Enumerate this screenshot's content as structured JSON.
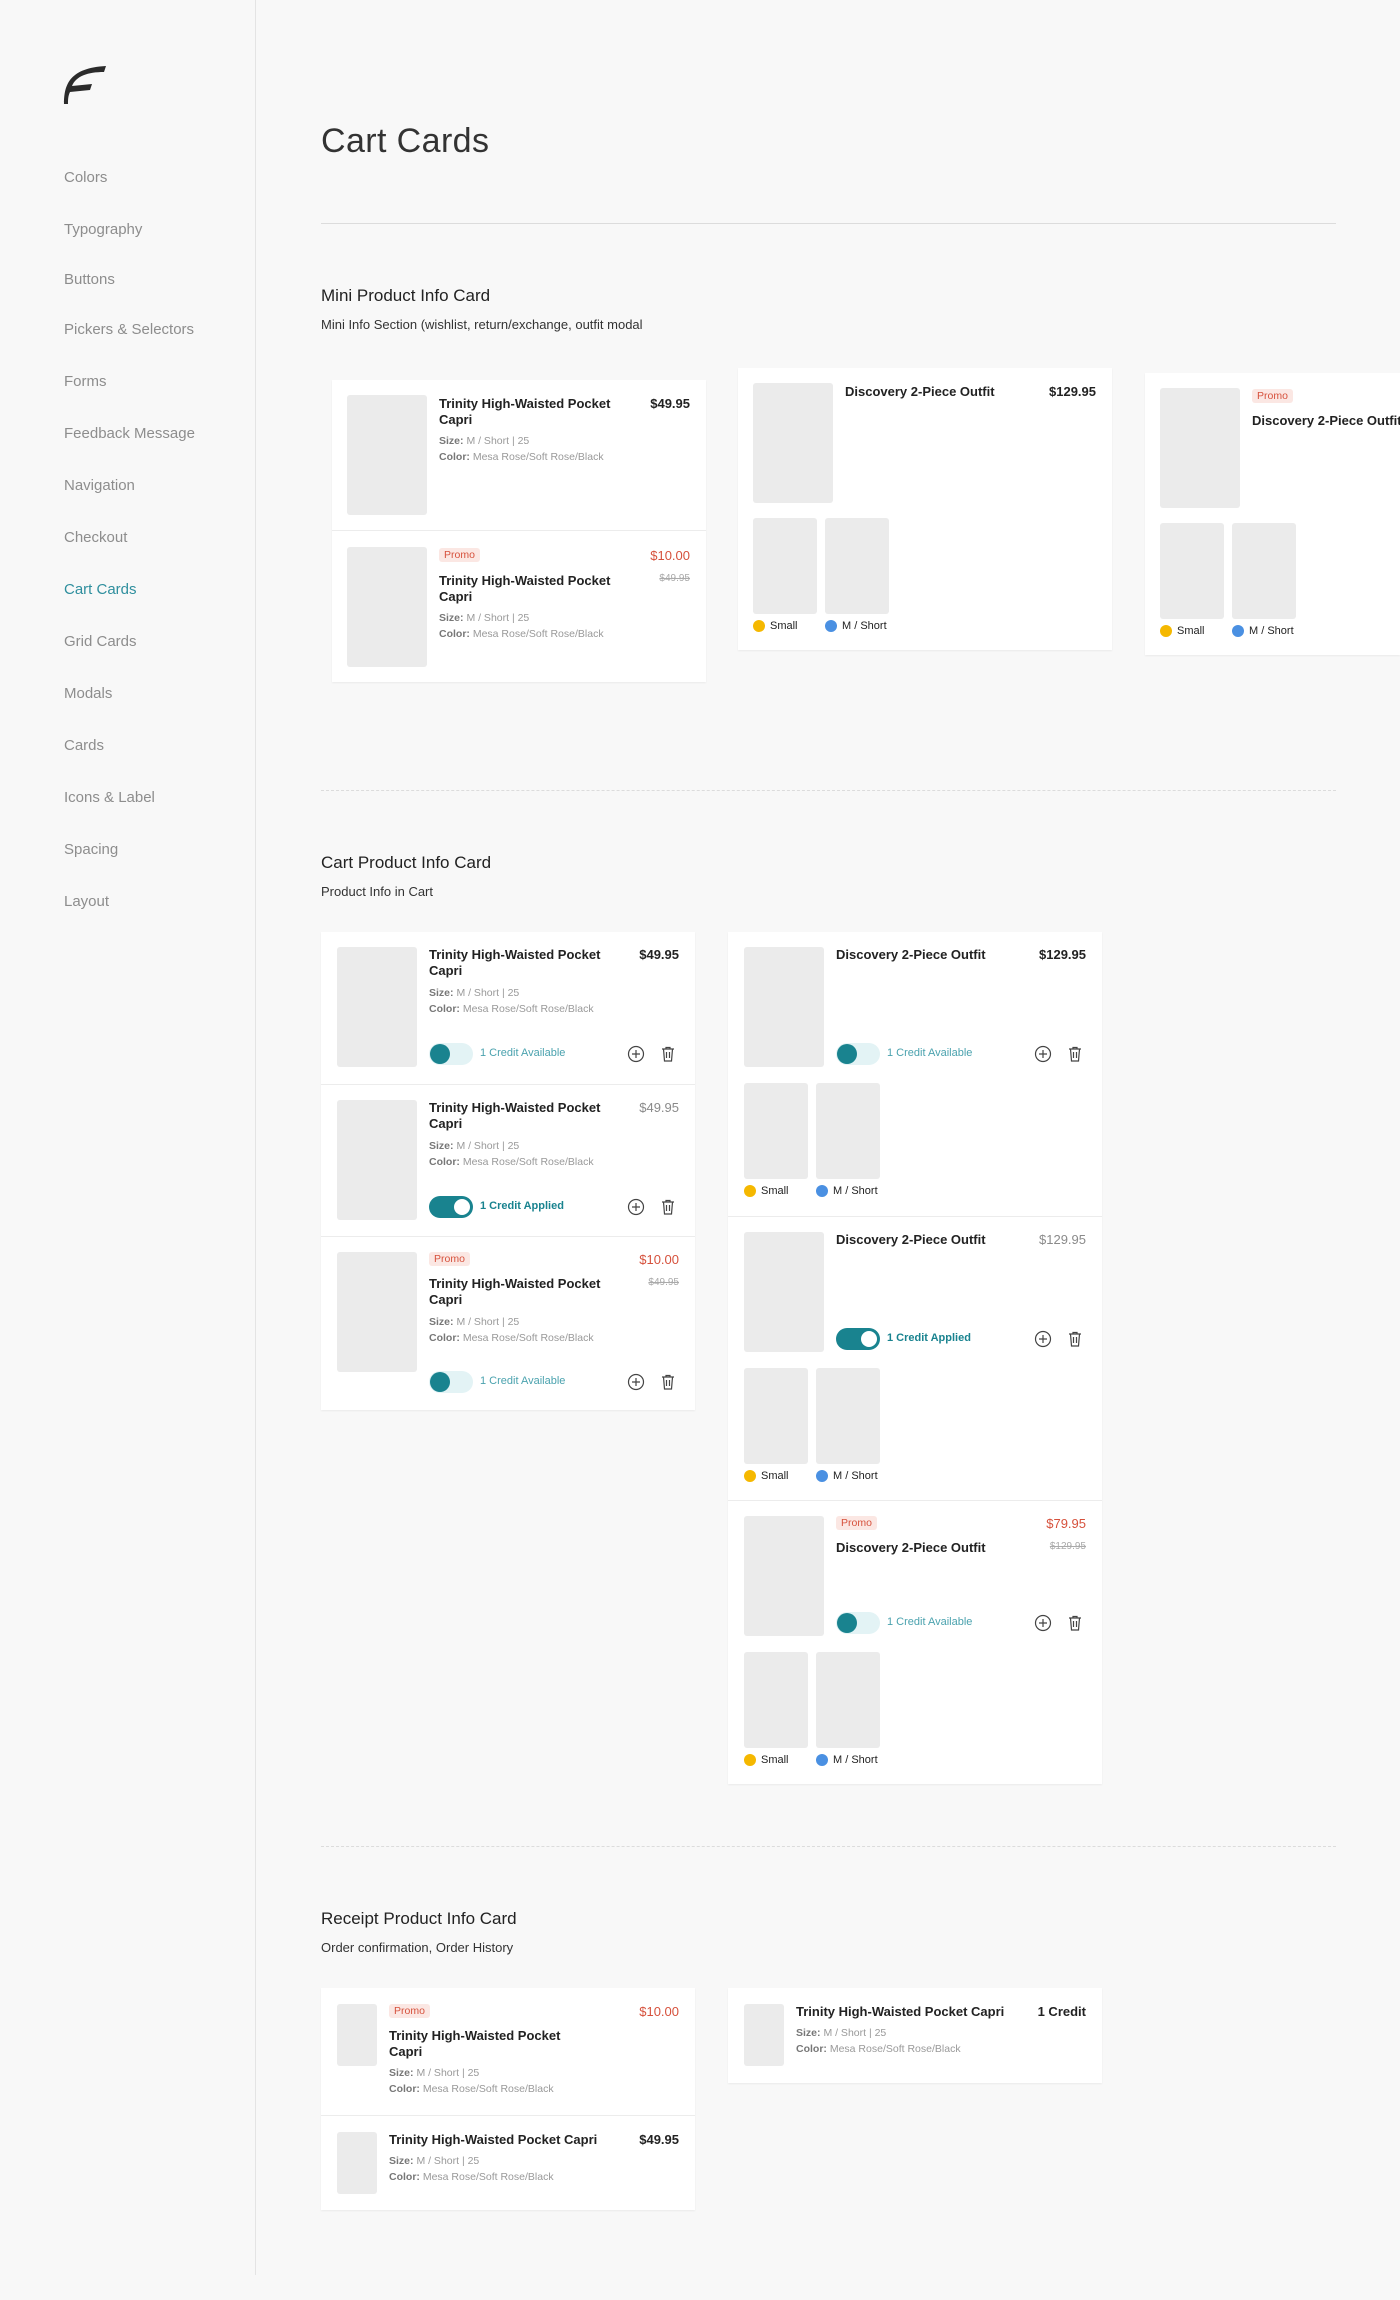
{
  "sidebar": {
    "items": [
      {
        "label": "Colors"
      },
      {
        "label": "Typography"
      },
      {
        "label": "Buttons"
      },
      {
        "label": "Pickers & Selectors"
      },
      {
        "label": "Forms"
      },
      {
        "label": "Feedback Message"
      },
      {
        "label": "Navigation"
      },
      {
        "label": "Checkout"
      },
      {
        "label": "Cart Cards",
        "active": true
      },
      {
        "label": "Grid Cards"
      },
      {
        "label": "Modals"
      },
      {
        "label": "Cards"
      },
      {
        "label": "Icons & Label"
      },
      {
        "label": "Spacing"
      },
      {
        "label": "Layout"
      }
    ]
  },
  "page": {
    "title": "Cart Cards"
  },
  "colors": {
    "accent": "#19838f",
    "promo": "#d6513c",
    "dot_small": "#f5b800",
    "dot_fit": "#4a90e2"
  },
  "labels": {
    "size": "Size:",
    "color": "Color:",
    "promo": "Promo",
    "small": "Small",
    "fit": "M / Short",
    "credit_available": "1 Credit Available",
    "credit_applied": "1 Credit Applied"
  },
  "products": {
    "trinity": {
      "name": "Trinity High-Waisted Pocket Capri",
      "size": "M / Short | 25",
      "color": "Mesa Rose/Soft Rose/Black"
    },
    "discovery": {
      "name": "Discovery 2-Piece Outfit"
    }
  },
  "sections": {
    "mini": {
      "title": "Mini Product Info Card",
      "subtitle": "Mini Info Section (wishlist, return/exchange, outfit modal",
      "card1": {
        "row1": {
          "price": "$49.95"
        },
        "row2": {
          "price": "$10.00",
          "old_price": "$49.95"
        }
      },
      "card2": {
        "price": "$129.95"
      }
    },
    "cart": {
      "title": "Cart Product Info Card",
      "subtitle": "Product Info in Cart",
      "left": {
        "row1": {
          "price": "$49.95",
          "credit_on": false
        },
        "row2": {
          "price": "$49.95",
          "credit_on": true
        },
        "row3": {
          "price": "$10.00",
          "old_price": "$49.95",
          "credit_on": false
        }
      },
      "right": {
        "row1": {
          "price": "$129.95",
          "credit_on": false
        },
        "row2": {
          "price": "$129.95",
          "credit_on": true
        },
        "row3": {
          "price": "$79.95",
          "old_price": "$129.95",
          "credit_on": false
        }
      }
    },
    "receipt": {
      "title": "Receipt Product Info Card",
      "subtitle": "Order confirmation, Order History",
      "left": {
        "row1": {
          "price": "$10.00"
        },
        "row2": {
          "price": "$49.95"
        }
      },
      "right": {
        "price": "1 Credit"
      }
    }
  }
}
